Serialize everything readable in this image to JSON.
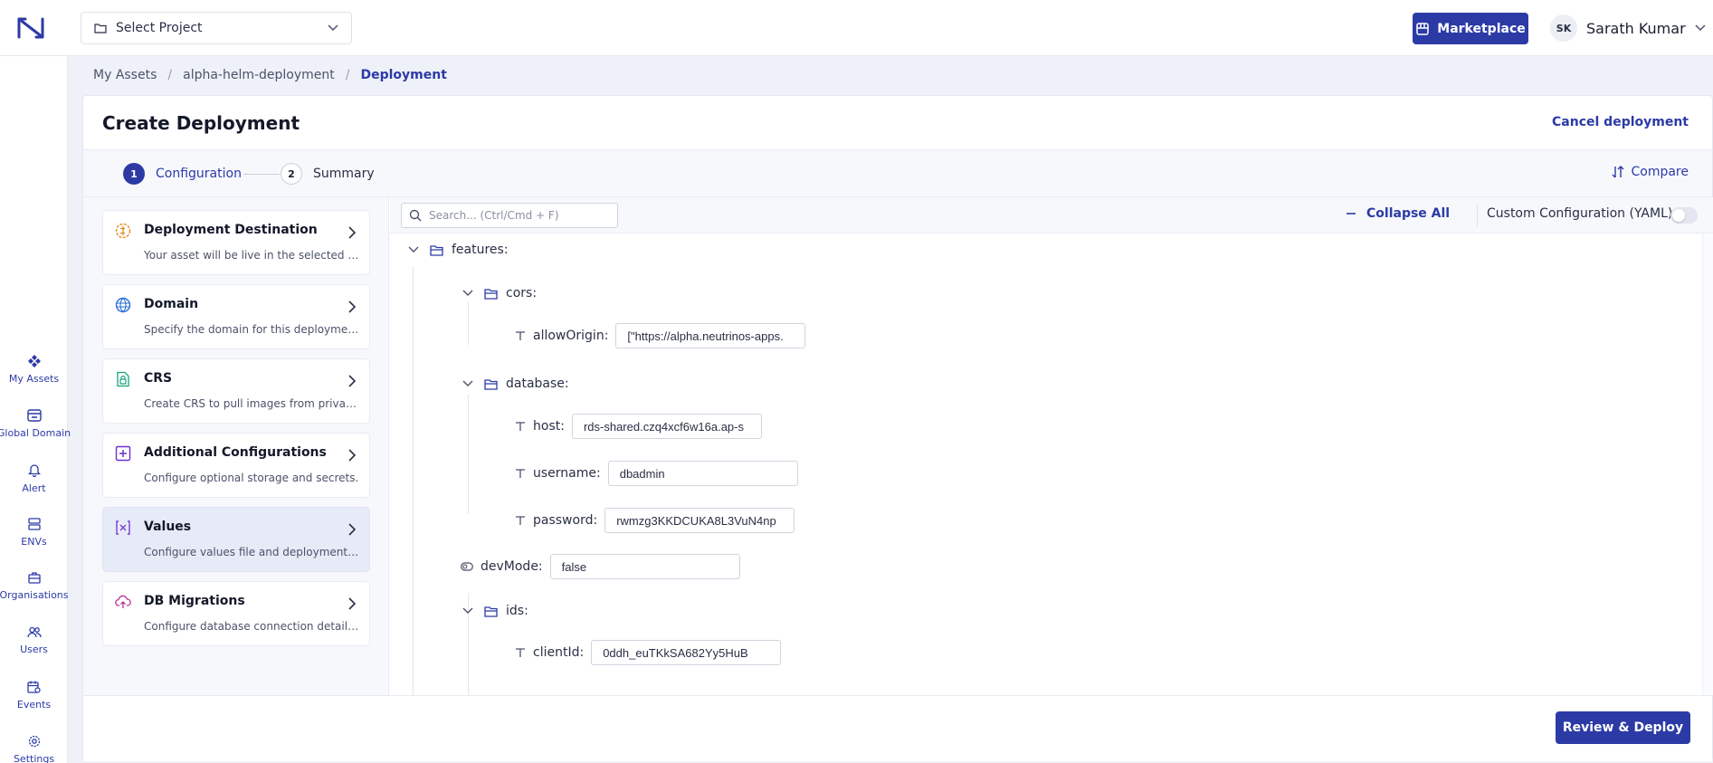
{
  "header": {
    "project_select_label": "Select Project",
    "marketplace_label": "Marketplace",
    "user_initials": "SK",
    "user_name": "Sarath Kumar"
  },
  "rail": {
    "items": [
      {
        "label": "My Assets",
        "icon": "assets-icon"
      },
      {
        "label": "Global Domain",
        "icon": "global-domain-icon"
      },
      {
        "label": "Alert",
        "icon": "bell-icon"
      },
      {
        "label": "ENVs",
        "icon": "envs-icon"
      },
      {
        "label": "Organisations",
        "icon": "briefcase-icon"
      },
      {
        "label": "Users",
        "icon": "users-icon"
      },
      {
        "label": "Events",
        "icon": "events-icon"
      },
      {
        "label": "Settings",
        "icon": "gear-icon"
      }
    ]
  },
  "breadcrumb": {
    "items": [
      "My Assets",
      "alpha-helm-deployment",
      "Deployment"
    ]
  },
  "page": {
    "title": "Create Deployment",
    "cancel_label": "Cancel deployment",
    "compare_label": "Compare"
  },
  "stepper": {
    "steps": [
      {
        "num": "1",
        "label": "Configuration"
      },
      {
        "num": "2",
        "label": "Summary"
      }
    ]
  },
  "sections": {
    "items": [
      {
        "title": "Deployment Destination",
        "desc": "Your asset will be live in the selected environment.",
        "icon": "destination-icon"
      },
      {
        "title": "Domain",
        "desc": "Specify the domain for this deployment.",
        "icon": "www-icon"
      },
      {
        "title": "CRS",
        "desc": "Create CRS to pull images from private registries.",
        "icon": "lock-file-icon"
      },
      {
        "title": "Additional Configurations",
        "desc": "Configure optional storage and secrets.",
        "icon": "plus-square-icon"
      },
      {
        "title": "Values",
        "desc": "Configure values file and deployment config.",
        "icon": "variable-icon"
      },
      {
        "title": "DB Migrations",
        "desc": "Configure database connection details for migrations.",
        "icon": "cloud-upload-icon"
      }
    ]
  },
  "values_panel": {
    "search_placeholder": "Search... (Ctrl/Cmd + F)",
    "collapse_all_label": "Collapse All",
    "custom_config_label": "Custom Configuration (YAML)",
    "tree": {
      "features": "features:",
      "cors": "cors:",
      "allowOrigin_key": "allowOrigin:",
      "allowOrigin_val": "[\"https://alpha.neutrinos-apps.",
      "database": "database:",
      "host_key": "host:",
      "host_val": "rds-shared.czq4xcf6w16a.ap-s",
      "username_key": "username:",
      "username_val": "dbadmin",
      "password_key": "password:",
      "password_val": "rwmzg3KKDCUKA8L3VuN4np",
      "devMode_key": "devMode:",
      "devMode_val": "false",
      "ids": "ids:",
      "clientId_key": "clientId:",
      "clientId_val": "0ddh_euTKkSA682Yy5HuB"
    }
  },
  "footer": {
    "review_label": "Review & Deploy"
  }
}
